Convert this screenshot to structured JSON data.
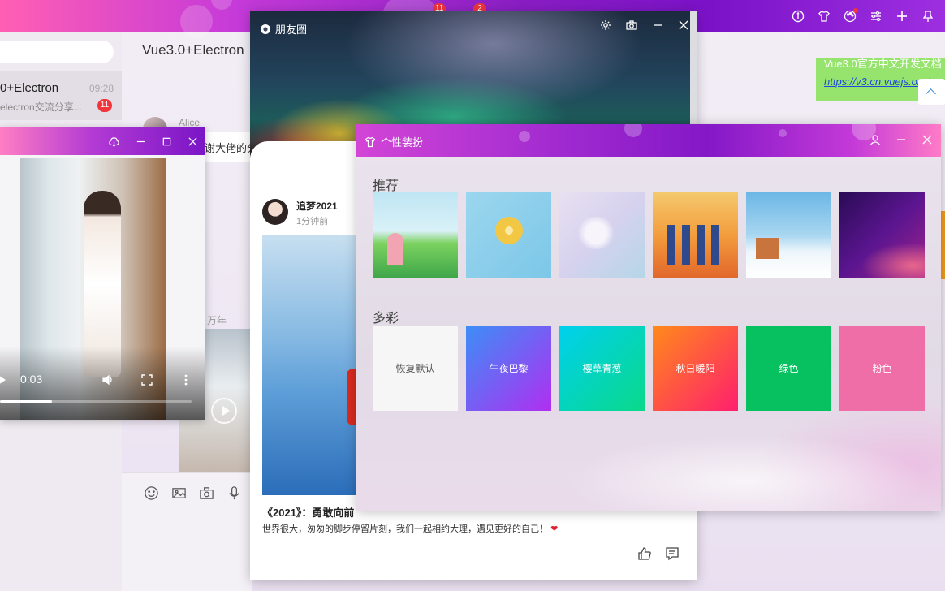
{
  "topbar": {
    "badge_one": "11",
    "badge_two": "2",
    "icons": [
      "info-icon",
      "shirt-icon",
      "palette-icon",
      "sliders-icon",
      "plus-icon",
      "pin-icon"
    ]
  },
  "session": {
    "name": "0+Electron",
    "time": "09:28",
    "preview": "electron交流分享...",
    "unread": "11"
  },
  "chat": {
    "title": "Vue3.0+Electron",
    "sender_name": "Alice",
    "message_fragment": "谢大佬的分",
    "time_fragment": "万年",
    "right_bubble_text": "Vue3.0官方中文开发文档",
    "right_bubble_link": "https://v3.cn.vuejs.org/"
  },
  "video_window": {
    "current_time": "0:03",
    "progress": 0.27
  },
  "moments_window": {
    "title": "朋友圈",
    "post": {
      "author": "追梦2021",
      "time": "1分钟前",
      "heading": "《2021》：勇敢向前",
      "text": "世界很大，匆匆的脚步停留片刻，我们一起相约大理，遇见更好的自己！",
      "heart": "❤"
    }
  },
  "skin_window": {
    "title": "个性装扮",
    "section_recommend": "推荐",
    "section_colorful": "多彩",
    "colors": [
      {
        "label": "恢复默认"
      },
      {
        "label": "午夜巴黎"
      },
      {
        "label": "樱草青葱"
      },
      {
        "label": "秋日暖阳"
      },
      {
        "label": "绿色"
      },
      {
        "label": "粉色"
      }
    ]
  }
}
